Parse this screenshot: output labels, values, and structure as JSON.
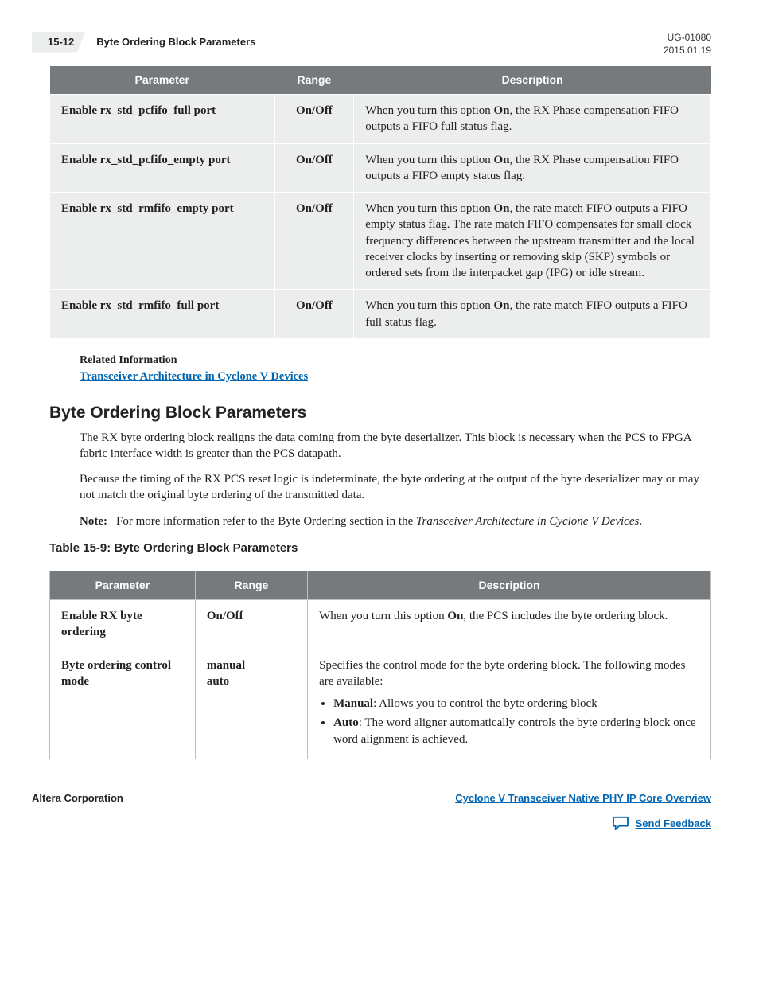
{
  "header": {
    "page_num": "15-12",
    "title": "Byte Ordering Block Parameters",
    "doc_id": "UG-01080",
    "date": "2015.01.19"
  },
  "table1": {
    "headers": [
      "Parameter",
      "Range",
      "Description"
    ],
    "rows": [
      {
        "param": "Enable rx_std_pcfifo_full port",
        "range": "On/Off",
        "desc_pre": "When you turn this option ",
        "desc_bold": "On",
        "desc_post": ", the RX Phase compensation FIFO outputs a FIFO full status flag."
      },
      {
        "param": "Enable rx_std_pcfifo_empty port",
        "range": "On/Off",
        "desc_pre": "When you turn this option ",
        "desc_bold": "On",
        "desc_post": ", the RX Phase compensation FIFO outputs a FIFO empty status flag."
      },
      {
        "param": "Enable rx_std_rmfifo_empty port",
        "range": "On/Off",
        "desc_pre": "When you turn this option ",
        "desc_bold": "On",
        "desc_post": ", the rate match FIFO outputs a FIFO empty status flag. The rate match FIFO compensates for small clock frequency differences between the upstream transmitter and the local receiver clocks by inserting or removing skip (SKP) symbols or ordered sets from the interpacket gap (IPG) or idle stream."
      },
      {
        "param": "Enable rx_std_rmfifo_full port",
        "range": "On/Off",
        "desc_pre": "When you turn this option ",
        "desc_bold": "On",
        "desc_post": ", the rate match FIFO outputs a FIFO full status flag."
      }
    ]
  },
  "related": {
    "label": "Related Information",
    "link": "Transceiver Architecture in Cyclone V Devices"
  },
  "section": {
    "heading": "Byte Ordering Block Parameters",
    "para1": "The RX byte ordering block realigns the data coming from the byte deserializer. This block is necessary when the PCS to FPGA fabric interface width is greater than the PCS datapath.",
    "para2": "Because the timing of the RX PCS reset logic is indeterminate, the byte ordering at the output of the byte deserializer may or may not match the original byte ordering of the transmitted data.",
    "note_label": "Note:",
    "note_text_pre": "For more information refer to the Byte Ordering section in the ",
    "note_text_italic": "Transceiver Architecture in Cyclone V Devices",
    "note_text_post": "."
  },
  "table2": {
    "caption": "Table 15-9: Byte Ordering Block Parameters",
    "headers": [
      "Parameter",
      "Range",
      "Description"
    ],
    "rows": [
      {
        "param": "Enable RX byte ordering",
        "range": "On/Off",
        "desc_pre": "When you turn this option ",
        "desc_bold": "On",
        "desc_post": ", the PCS includes the byte ordering block."
      },
      {
        "param": "Byte ordering control mode",
        "range_lines": [
          "manual",
          "auto"
        ],
        "desc_intro": "Specifies the control mode for the byte ordering block. The following modes are available:",
        "bullets": [
          {
            "bold": "Manual",
            "text": ": Allows you to control the byte ordering block"
          },
          {
            "bold": "Auto",
            "text": ": The word aligner automatically controls the byte ordering block once word alignment is achieved."
          }
        ]
      }
    ]
  },
  "footer": {
    "left": "Altera Corporation",
    "right_link": "Cyclone V Transceiver Native PHY IP Core Overview",
    "feedback": "Send Feedback"
  }
}
